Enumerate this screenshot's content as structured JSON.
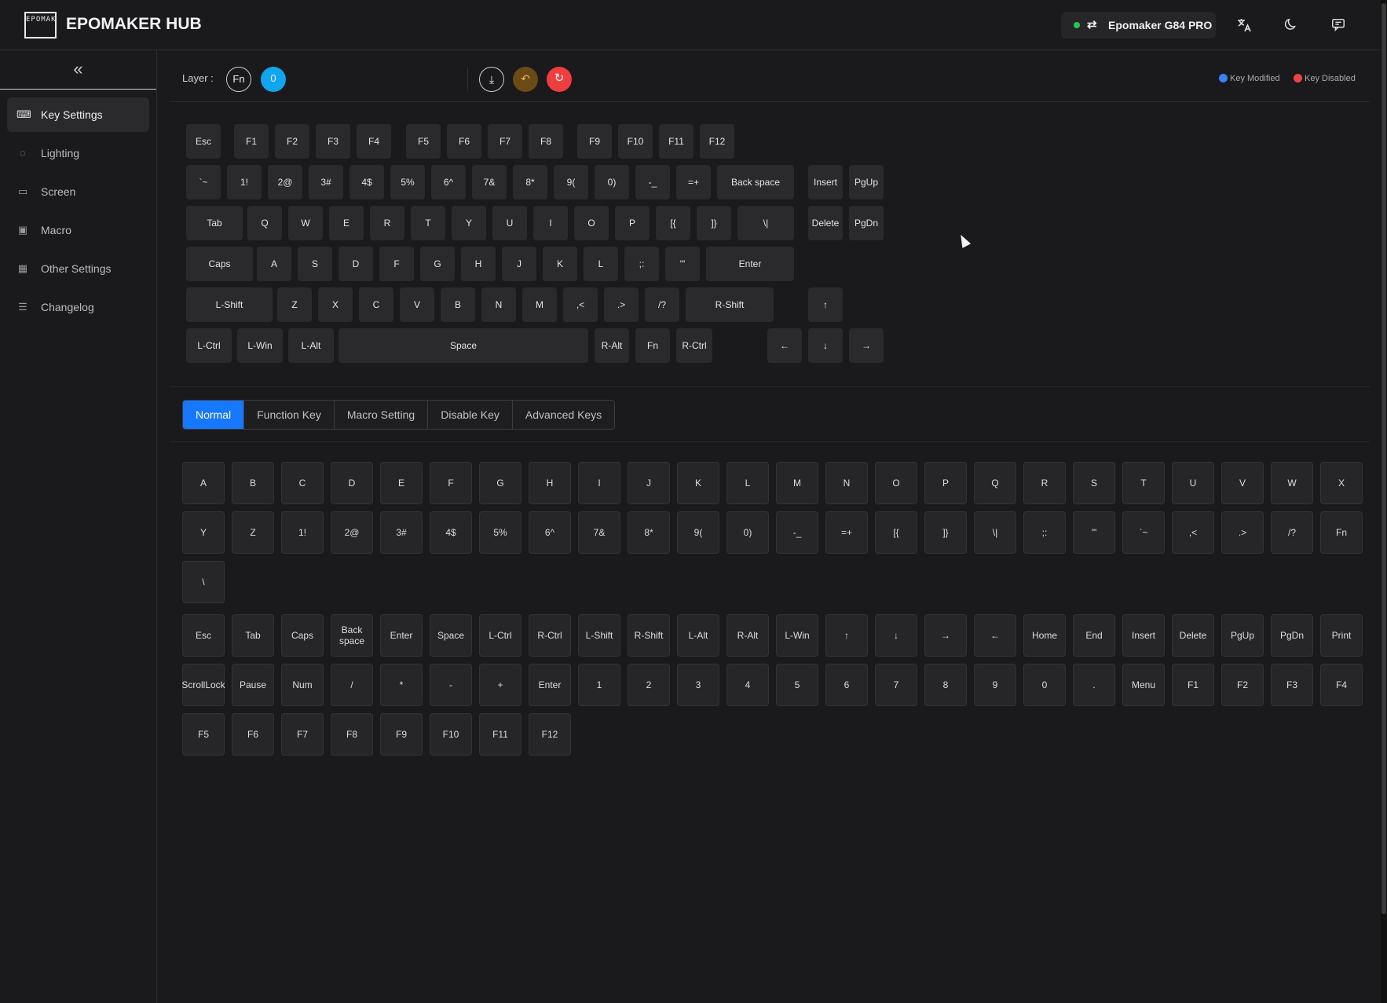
{
  "app": {
    "title": "EPOMAKER HUB",
    "logo_text": "EPOMAKER"
  },
  "device": {
    "name": "Epomaker G84 PRO",
    "status": "connected",
    "swap_icon": "swap-arrows-icon"
  },
  "header_icons": [
    "translate-icon",
    "moon-icon",
    "chat-icon"
  ],
  "sidebar": {
    "collapse_icon": "«",
    "items": [
      {
        "label": "Key Settings",
        "icon": "keyboard-icon",
        "active": true
      },
      {
        "label": "Lighting",
        "icon": "bulb-icon"
      },
      {
        "label": "Screen",
        "icon": "monitor-icon"
      },
      {
        "label": "Macro",
        "icon": "macro-icon"
      },
      {
        "label": "Other Settings",
        "icon": "grid-icon"
      },
      {
        "label": "Changelog",
        "icon": "document-icon"
      }
    ]
  },
  "layer": {
    "label": "Layer :",
    "fn": "Fn",
    "active": "0"
  },
  "toolbar": {
    "download": "⤓",
    "undo": "↶",
    "reset": "↻"
  },
  "legend": [
    {
      "label": "Key Modified",
      "color": "#3b82f6"
    },
    {
      "label": "Key Disabled",
      "color": "#ef4444"
    }
  ],
  "keyboard_rows": [
    [
      "Esc",
      "F1",
      "F2",
      "F3",
      "F4",
      "F5",
      "F6",
      "F7",
      "F8",
      "F9",
      "F10",
      "F11",
      "F12"
    ],
    [
      "`~",
      "1!",
      "2@",
      "3#",
      "4$",
      "5%",
      "6^",
      "7&",
      "8*",
      "9(",
      "0)",
      "-_",
      "=+",
      "Back space",
      "Insert",
      "PgUp"
    ],
    [
      "Tab",
      "Q",
      "W",
      "E",
      "R",
      "T",
      "Y",
      "U",
      "I",
      "O",
      "P",
      "[{",
      "]}",
      "\\|",
      "Delete",
      "PgDn"
    ],
    [
      "Caps",
      "A",
      "S",
      "D",
      "F",
      "G",
      "H",
      "J",
      "K",
      "L",
      ";:",
      "'\"",
      "Enter"
    ],
    [
      "L-Shift",
      "Z",
      "X",
      "C",
      "V",
      "B",
      "N",
      "M",
      ",<",
      ".>",
      "/?",
      "R-Shift",
      "↑"
    ],
    [
      "L-Ctrl",
      "L-Win",
      "L-Alt",
      "Space",
      "R-Alt",
      "Fn",
      "R-Ctrl",
      "←",
      "↓",
      "→"
    ]
  ],
  "tabs": [
    "Normal",
    "Function Key",
    "Macro Setting",
    "Disable Key",
    "Advanced Keys"
  ],
  "active_tab": "Normal",
  "palette_groups": [
    [
      "A",
      "B",
      "C",
      "D",
      "E",
      "F",
      "G",
      "H",
      "I",
      "J",
      "K",
      "L",
      "M",
      "N",
      "O",
      "P",
      "Q",
      "R",
      "S",
      "T",
      "U",
      "V",
      "W",
      "X",
      "Y",
      "Z",
      "1!",
      "2@",
      "3#",
      "4$",
      "5%",
      "6^",
      "7&",
      "8*",
      "9(",
      "0)",
      "-_",
      "=+",
      "[{",
      "]}",
      "\\|",
      ";:",
      "'\"",
      "`~",
      ",<",
      ".>",
      "/?",
      "Fn",
      "\\"
    ],
    [
      "Esc",
      "Tab",
      "Caps",
      "Back space",
      "Enter",
      "Space",
      "L-Ctrl",
      "R-Ctrl",
      "L-Shift",
      "R-Shift",
      "L-Alt",
      "R-Alt",
      "L-Win",
      "↑",
      "↓",
      "→",
      "←",
      "Home",
      "End",
      "Insert",
      "Delete",
      "PgUp",
      "PgDn",
      "Print",
      "ScrollLock",
      "Pause",
      "Num",
      "/",
      "*",
      "-",
      "+",
      "Enter",
      "1",
      "2",
      "3",
      "4",
      "5",
      "6",
      "7",
      "8",
      "9",
      "0",
      ".",
      "Menu",
      "F1",
      "F2",
      "F3",
      "F4",
      "F5",
      "F6",
      "F7",
      "F8",
      "F9",
      "F10",
      "F11",
      "F12"
    ]
  ]
}
